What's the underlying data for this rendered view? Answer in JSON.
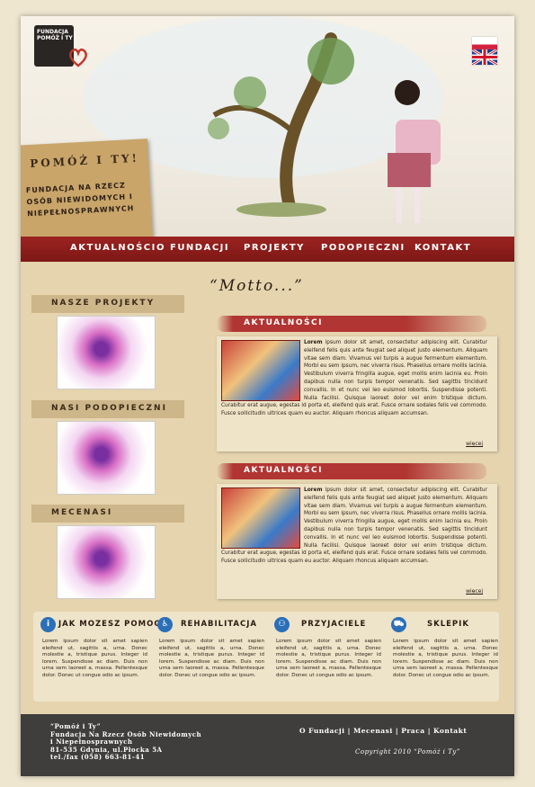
{
  "header": {
    "logo_text": "FUNDACJA POMÓŻ I TY",
    "motto_title": "POMÓŻ I TY!",
    "motto_subtitle": "FUNDACJA NA RZECZ OSÓB NIEWIDOMYCH I NIEPEŁNOSPRAWNYCH"
  },
  "nav": [
    "AKTUALNOŚCI",
    "O FUNDACJI",
    "PROJEKTY",
    "PODOPIECZNI",
    "KONTAKT"
  ],
  "sidebar": [
    "NASZE PROJEKTY",
    "NASI PODOPIECZNI",
    "MECENASI"
  ],
  "motto": "“Motto...”",
  "news": [
    {
      "title": "AKTUALNOŚCI",
      "lead": "Lorem",
      "body": " ipsum dolor sit amet, consectetur adipiscing elit. Curabitur eleifend felis quis ante feugiat sed aliquet justo elementum. Aliquam vitae sem diam. Vivamus vel turpis a augue fermentum elementum. Morbi eu sem ipsum, nec viverra risus. Phasellus ornare mollis lacinia. Vestibulum viverra fringilla augue, eget mollis enim lacinia eu. Proin dapibus nulla non turpis tempor venenatis. Sed sagittis tincidunt convallis. In et nunc vel leo euismod lobortis. Suspendisse potenti. Nulla facilisi. Quisque laoreet dolor vel enim tristique dictum. Curabitur erat augue, egestas id porta et, eleifend quis erat. Fusce ornare sodales felis vel commodo. Fusce sollicitudin ultrices quam eu auctor. Aliquam rhoncus aliquam accumsan.",
      "more": "więcej"
    },
    {
      "title": "AKTUALNOŚCI",
      "lead": "Lorem",
      "body": " ipsum dolor sit amet, consectetur adipiscing elit. Curabitur eleifend felis quis ante feugiat sed aliquet justo elementum. Aliquam vitae sem diam. Vivamus vel turpis a augue fermentum elementum. Morbi eu sem ipsum, nec viverra risus. Phasellus ornare mollis lacinia. Vestibulum viverra fringilla augue, eget mollis enim lacinia eu. Proin dapibus nulla non turpis tempor venenatis. Sed sagittis tincidunt convallis. In et nunc vel leo euismod lobortis. Suspendisse potenti. Nulla facilisi. Quisque laoreet dolor vel enim tristique dictum. Curabitur erat augue, egestas id porta et, eleifend quis erat. Fusce ornare sodales felis vel commodo. Fusce sollicitudin ultrices quam eu auctor. Aliquam rhoncus aliquam accumsan.",
      "more": "więcej"
    }
  ],
  "boxes": [
    {
      "title": "JAK MOZESZ POMOC",
      "icon": "info-icon",
      "text": "Lorem ipsum dolor sit amet sapien eleifend ut, sagittis a, urna. Donec molestie a, tristique purus. Integer id lorem. Suspendisse ac diam. Duis non urna sem laoreet a, massa. Pellentesque dolor. Donec ut congue odio ac ipsum."
    },
    {
      "title": "REHABILITACJA",
      "icon": "wheelchair-icon",
      "text": "Lorem ipsum dolor sit amet sapien eleifend ut, sagittis a, urna. Donec molestie a, tristique purus. Integer id lorem. Suspendisse ac diam. Duis non urna sem laoreet a, massa. Pellentesque dolor. Donec ut congue odio ac ipsum."
    },
    {
      "title": "PRZYJACIELE",
      "icon": "people-icon",
      "text": "Lorem ipsum dolor sit amet sapien eleifend ut, sagittis a, urna. Donec molestie a, tristique purus. Integer id lorem. Suspendisse ac diam. Duis non urna sem laoreet a, massa. Pellentesque dolor. Donec ut congue odio ac ipsum."
    },
    {
      "title": "SKLEPIK",
      "icon": "cart-icon",
      "text": "Lorem ipsum dolor sit amet sapien eleifend ut, sagittis a, urna. Donec molestie a, tristique purus. Integer id lorem. Suspendisse ac diam. Duis non urna sem laoreet a, massa. Pellentesque dolor. Donec ut congue odio ac ipsum."
    }
  ],
  "footer": {
    "org": "“Pomóż i Ty”",
    "org_line2": "Fundacja Na Rzecz Osób Niewidomych",
    "org_line3": "i Niepełnosprawnych",
    "address": "81-535 Gdynia, ul.Płocka 5A",
    "phone": "tel./fax (058) 663-81-41",
    "links": [
      "O Fundacji",
      "Mecenasi",
      "Praca",
      "Kontakt"
    ],
    "copyright": "Copyright 2010 “Pomóż i Ty”"
  },
  "colors": {
    "nav": "#8e1f1c",
    "banner": "#b13532",
    "footer": "#3f3e3c",
    "icon": "#2a6fb8"
  }
}
